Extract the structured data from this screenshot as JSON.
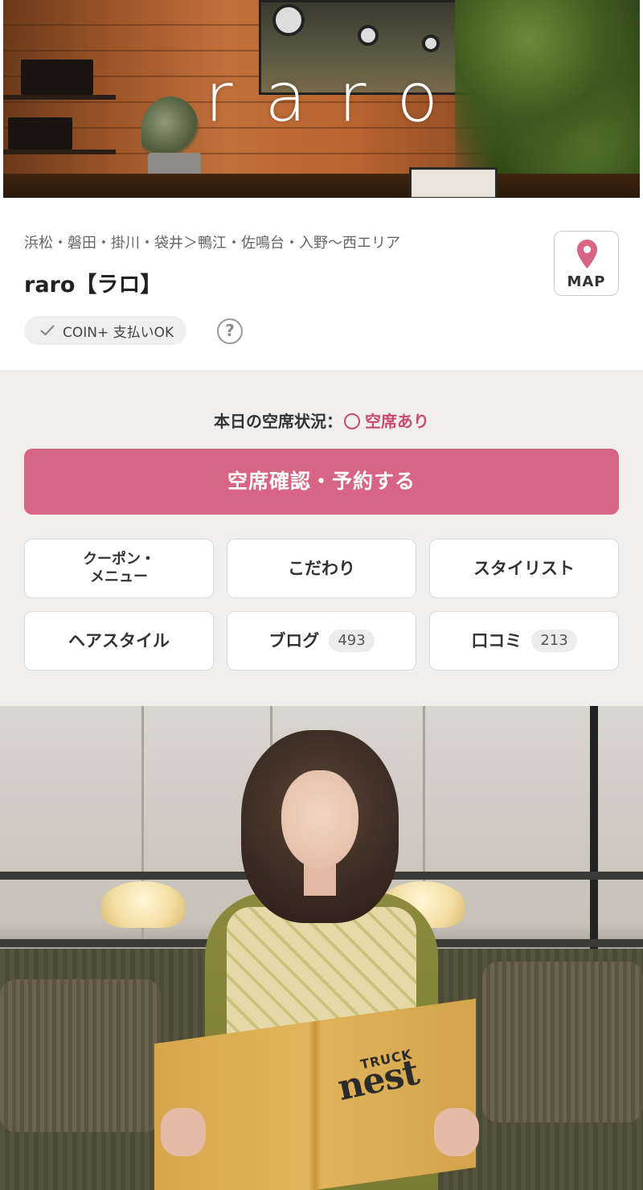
{
  "hero": {
    "logo_text": "raro"
  },
  "salon": {
    "area": "浜松・磐田・掛川・袋井＞鴨江・佐鳴台・入野〜西エリア",
    "name": "raro【ラロ】",
    "map_label": "MAP",
    "coin_badge": "COIN+ 支払いOK",
    "help_glyph": "?"
  },
  "availability": {
    "label": "本日の空席状況：",
    "value": "空席あり"
  },
  "reserve_button": "空席確認・予約する",
  "nav": {
    "coupon_line1": "クーポン・",
    "coupon_line2": "メニュー",
    "kodawari": "こだわり",
    "stylist": "スタイリスト",
    "hairstyle": "ヘアスタイル",
    "blog": "ブログ",
    "blog_count": "493",
    "review": "口コミ",
    "review_count": "213"
  },
  "photo": {
    "book_title": "nest",
    "book_subtitle": "TRUCK"
  },
  "colors": {
    "accent": "#d76583",
    "status_accent": "#c94a6e",
    "booking_bg": "#f1efee"
  },
  "icons": {
    "map": "map-pin-icon",
    "coin": "check-icon",
    "help": "question-circle-icon",
    "availability": "circle-available-icon"
  }
}
